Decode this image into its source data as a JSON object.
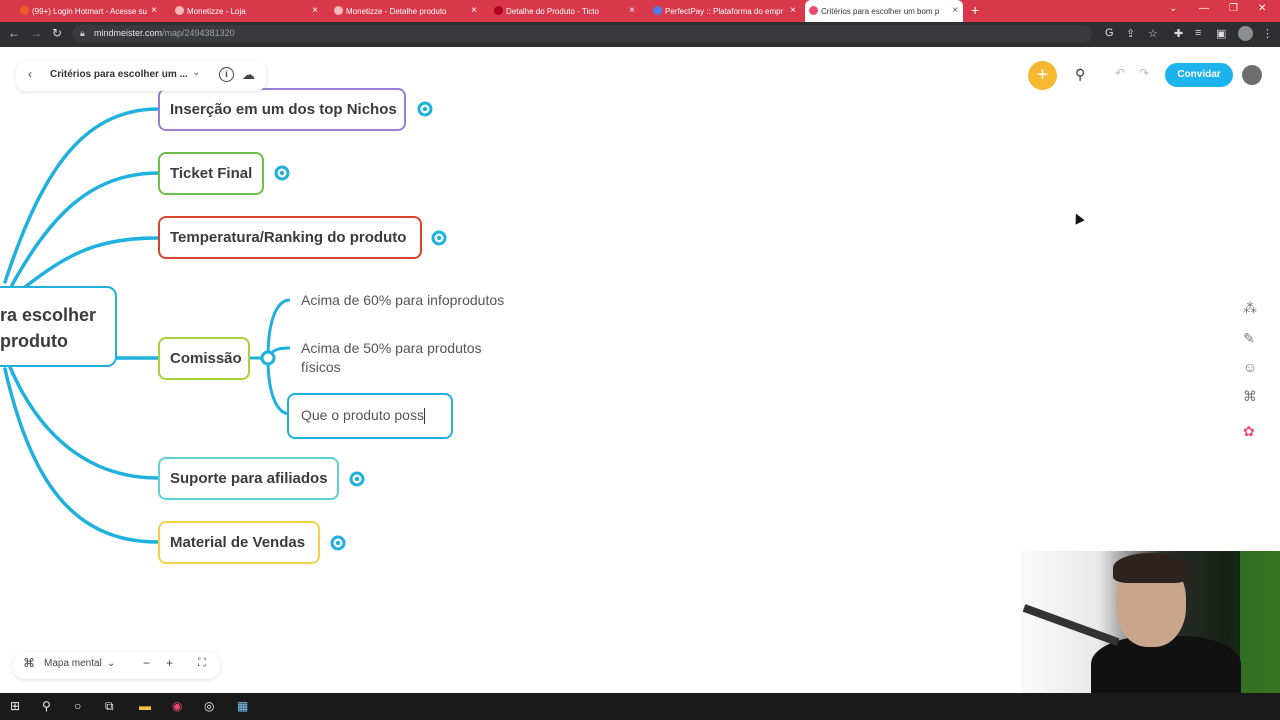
{
  "browser": {
    "tabs": [
      {
        "title": "(99+) Login Hotmart - Acesse su"
      },
      {
        "title": "Monetizze - Loja"
      },
      {
        "title": "Monetizze - Detalhe produto"
      },
      {
        "title": "Detalhe do Produto - Ticto"
      },
      {
        "title": "PerfectPay :: Plataforma do empr"
      },
      {
        "title": "Critérios para escolher um bom p"
      }
    ],
    "url_host": "mindmeister.com",
    "url_path": "/map/2494381320"
  },
  "app": {
    "map_title": "Critérios para escolher um ...",
    "info_label": "i",
    "invite_label": "Convidar",
    "view_mode": "Mapa mental",
    "zoom_out": "−",
    "zoom_in": "+"
  },
  "mindmap": {
    "root_line1": "ra escolher",
    "root_line2": "produto",
    "branches": [
      {
        "label": "Inserção em um dos top Nichos",
        "color": "#9b7fd4"
      },
      {
        "label": "Ticket Final",
        "color": "#6cc04a"
      },
      {
        "label": "Temperatura/Ranking do produto",
        "color": "#d6462e"
      },
      {
        "label": "Comissão",
        "color": "#a6d23a"
      },
      {
        "label": "Suporte para afiliados",
        "color": "#5fd1d0"
      },
      {
        "label": "Material de Vendas",
        "color": "#f2d24b"
      }
    ],
    "comissao_children": [
      {
        "line1": "Acima de 60% para infoprodutos"
      },
      {
        "line1": "Acima de 50% para produtos",
        "line2": "físicos"
      }
    ],
    "editing_text": "Que o produto poss",
    "branch_color": "#1fb0dc"
  }
}
